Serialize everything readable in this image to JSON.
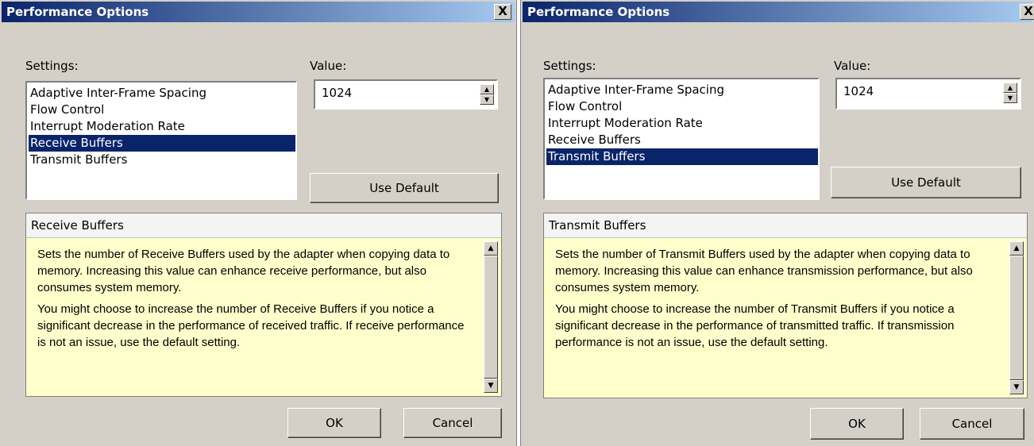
{
  "dialogs": [
    {
      "title": "Performance Options",
      "close_glyph": "X",
      "settings_label": "Settings:",
      "value_label": "Value:",
      "settings_items": [
        "Adaptive Inter-Frame Spacing",
        "Flow Control",
        "Interrupt Moderation Rate",
        "Receive Buffers",
        "Transmit Buffers"
      ],
      "selected_index": 3,
      "value": "1024",
      "use_default_label": "Use Default",
      "description_title": "Receive Buffers",
      "description_paragraphs": [
        "Sets the number of Receive Buffers used by the adapter when copying data to memory. Increasing this value can enhance receive performance, but also consumes system memory.",
        "You might choose to increase the number of Receive Buffers if you notice a significant decrease in the performance of received traffic. If receive performance is not an issue, use the default setting."
      ],
      "ok_label": "OK",
      "cancel_label": "Cancel"
    },
    {
      "title": "Performance Options",
      "close_glyph": "X",
      "settings_label": "Settings:",
      "value_label": "Value:",
      "settings_items": [
        "Adaptive Inter-Frame Spacing",
        "Flow Control",
        "Interrupt Moderation Rate",
        "Receive Buffers",
        "Transmit Buffers"
      ],
      "selected_index": 4,
      "value": "1024",
      "use_default_label": "Use Default",
      "description_title": "Transmit Buffers",
      "description_paragraphs": [
        "Sets the number of Transmit Buffers used by the adapter when copying data to memory. Increasing this value can enhance transmission performance, but also consumes system memory.",
        "You might choose to increase the number of Transmit Buffers if you notice a significant decrease in the performance of transmitted traffic. If transmission performance is not an issue, use the default setting."
      ],
      "ok_label": "OK",
      "cancel_label": "Cancel"
    }
  ],
  "icons": {
    "spin_up": "up-arrow-icon",
    "spin_down": "down-arrow-icon",
    "scroll_up": "up-arrow-icon",
    "scroll_down": "down-arrow-icon"
  }
}
